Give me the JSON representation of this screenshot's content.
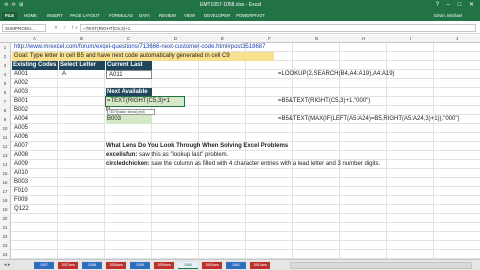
{
  "titlebar": {
    "quick_access": "⟲ ⟳ ⊞",
    "title": "EMT1057-1058.xlsx - Excel",
    "window_controls": "? – □ ✕"
  },
  "ribbon": {
    "file": "FILE",
    "tabs": [
      "HOME",
      "INSERT",
      "PAGE LAYOUT",
      "FORMULAS",
      "DATA",
      "REVIEW",
      "VIEW",
      "DEVELOPER",
      "POWERPIVOT"
    ],
    "user": "Girvin, Michael"
  },
  "formula_bar": {
    "name_box": "SUMPRODU...",
    "fx": "✕ ✓ fx",
    "formula": "=TEXT(RIGHT(C5,3)+1"
  },
  "columns": [
    "A",
    "B",
    "C",
    "D",
    "E",
    "F",
    "G",
    "H",
    "I",
    "J"
  ],
  "rows": [
    "1",
    "2",
    "3",
    "4",
    "5",
    "6",
    "7",
    "8",
    "9",
    "10",
    "11",
    "12",
    "13",
    "14",
    "15",
    "16",
    "17",
    "18",
    "19",
    "20",
    "21",
    "22",
    "23",
    "24"
  ],
  "cells": {
    "url": "http://www.mrexcel.com/forum/excel-questions/713666-next-customer-code.html#post3518687",
    "goal": "Goal: Type letter in cell B5 and have next code automatically generated in cell C9",
    "h_existing": "Existing Codes",
    "h_select": "Select Letter",
    "h_current": "Current Last",
    "b5": "A",
    "c5": "A011",
    "e5": "=LOOKUP(2,SEARCH(B4,A4:A19),A4:A19)",
    "next_label": "Next Available",
    "c7": "=TEXT(RIGHT(C5,3)+1",
    "e7": "=B5&TEXT(RIGHT(C5,3)+1,\"000\")",
    "c8": "N",
    "c9": "B003",
    "e9": "=B5&TEXT(MAX(IF(LEFT(A5:A24)=B5,RIGHT(A5:A24,3)+1)),\"000\")",
    "codes": [
      "A001",
      "A002",
      "A003",
      "B001",
      "B002",
      "A004",
      "A005",
      "A006",
      "A007",
      "A008",
      "A009",
      "A010",
      "B003",
      "F010",
      "F009",
      "Q122"
    ],
    "lens_q": "What Lens Do You Look Through When Solving Excel Problems",
    "excelisfun_name": "excelisfun:",
    "excelisfun_text": " saw this as \"lookup last\" problem.",
    "circledchicken_name": "circledchicken:",
    "circledchicken_text": " saw the column as filled with 4 character entries with a lead letter and 3 number digits."
  },
  "tooltip": "TEXT(value, format_text)",
  "sheet_tabs": [
    {
      "label": "1057",
      "color": "#2e6fbf"
    },
    {
      "label": "1057ans",
      "color": "#c0302a"
    },
    {
      "label": "1058",
      "color": "#2e6fbf"
    },
    {
      "label": "1058ans",
      "color": "#c0302a"
    },
    {
      "label": "1059",
      "color": "#2e6fbf"
    },
    {
      "label": "1059ans",
      "color": "#c0302a"
    },
    {
      "label": "1060",
      "color": "#e8eef7"
    },
    {
      "label": "1060ans",
      "color": "#c0302a"
    },
    {
      "label": "1061",
      "color": "#2e6fbf"
    },
    {
      "label": "1061ans",
      "color": "#c0302a"
    }
  ]
}
